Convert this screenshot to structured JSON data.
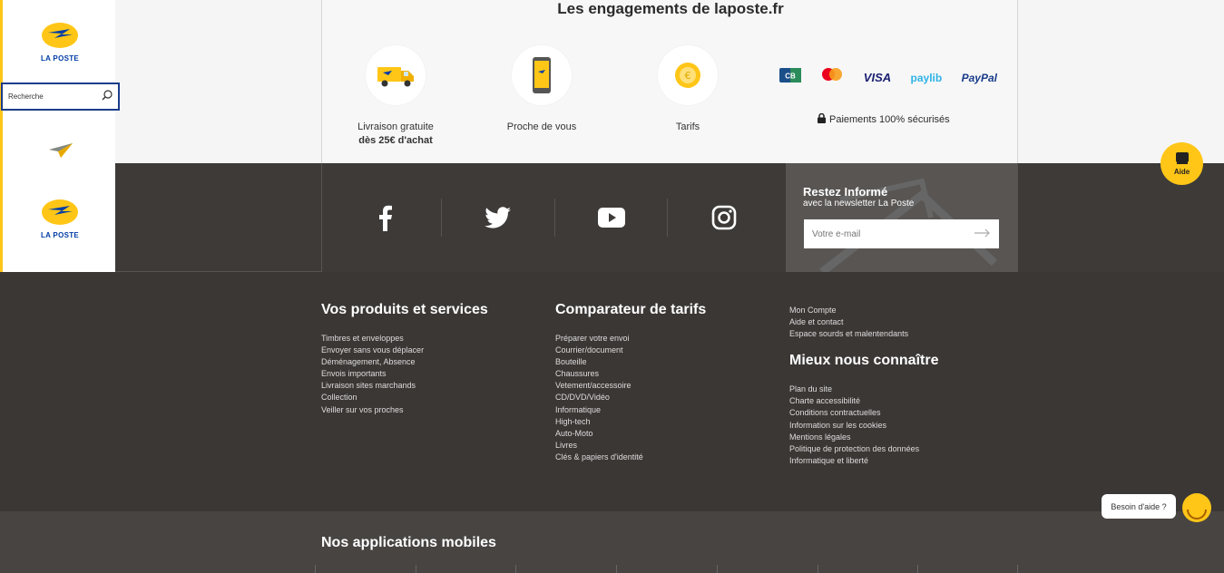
{
  "brand": {
    "logo_text": "LA POSTE",
    "colors": {
      "yellow": "#ffc617",
      "blue": "#003da5",
      "dark": "#3b3735"
    }
  },
  "search": {
    "value": "Recherche"
  },
  "engagements": {
    "title": "Les engagements de laposte.fr",
    "items": [
      {
        "icon": "delivery-truck-icon",
        "label": "Livraison gratuite",
        "label2": "dès 25€ d'achat"
      },
      {
        "icon": "smartphone-icon",
        "label": "Proche de vous",
        "label2": ""
      },
      {
        "icon": "coin-icon",
        "label": "Tarifs",
        "label2": ""
      }
    ],
    "payments": [
      "CB",
      "Mastercard",
      "VISA",
      "paylib",
      "PayPal"
    ],
    "secure_label": "Paiements 100% sécurisés"
  },
  "social": [
    "facebook-icon",
    "twitter-icon",
    "youtube-icon",
    "instagram-icon"
  ],
  "newsletter": {
    "title": "Restez Informé",
    "subtitle": "avec la newsletter La Poste",
    "placeholder": "Votre e-mail"
  },
  "footer": {
    "products": {
      "title": "Vos produits et services",
      "links": [
        "Timbres et enveloppes",
        "Envoyer sans vous déplacer",
        "Déménagement, Absence",
        "Envois importants",
        "Livraison sites marchands",
        "Collection",
        "Veiller sur vos proches"
      ]
    },
    "comparator": {
      "title": "Comparateur de tarifs",
      "links": [
        "Préparer votre envoi",
        "Courrier/document",
        "Bouteille",
        "Chaussures",
        "Vetement/accessoire",
        "CD/DVD/Vidéo",
        "Informatique",
        "High-tech",
        "Auto-Moto",
        "Livres",
        "Clés & papiers d'identité"
      ]
    },
    "account": {
      "links": [
        "Mon Compte",
        "Aide et contact",
        "Espace sourds et malentendants"
      ]
    },
    "about": {
      "title": "Mieux nous connaître",
      "links": [
        "Plan du site",
        "Charte accessibilité",
        "Conditions contractuelles",
        "Information sur les cookies",
        "Mentions légales",
        "Politique de protection des données",
        "Informatique et liberté"
      ]
    }
  },
  "apps": {
    "title": "Nos applications mobiles"
  },
  "help": {
    "aide_label": "Aide",
    "bubble": "Besoin d'aide ?"
  }
}
